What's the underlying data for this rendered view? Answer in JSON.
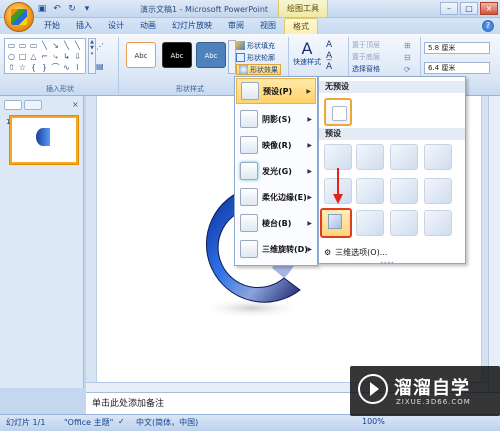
{
  "titlebar": {
    "doc_title": "演示文稿1 - Microsoft PowerPoint",
    "context_tab_group": "绘图工具",
    "qat_icons": [
      "save-icon",
      "undo-icon",
      "redo-icon",
      "customize-icon"
    ],
    "window_controls": {
      "minimize": "–",
      "maximize": "□",
      "close": "×"
    }
  },
  "tabs": [
    {
      "label": "开始"
    },
    {
      "label": "插入"
    },
    {
      "label": "设计"
    },
    {
      "label": "动画"
    },
    {
      "label": "幻灯片放映"
    },
    {
      "label": "审阅"
    },
    {
      "label": "视图"
    },
    {
      "label": "格式"
    }
  ],
  "ribbon": {
    "insert_shapes_label": "插入形状",
    "shape_styles_label": "形状样式",
    "style_sample": "Abc",
    "shape_fill": "形状填充",
    "shape_outline": "形状轮廓",
    "shape_effects": "形状效果",
    "quick_styles": "快速样式",
    "bring_front": "置于顶层",
    "send_back": "置于底层",
    "selection_pane": "选择窗格",
    "height_value": "5.8 厘米",
    "width_value": "6.4 厘米"
  },
  "effects_menu": {
    "items": [
      {
        "label": "预设(P)"
      },
      {
        "label": "阴影(S)"
      },
      {
        "label": "映像(R)"
      },
      {
        "label": "发光(G)"
      },
      {
        "label": "柔化边缘(E)"
      },
      {
        "label": "棱台(B)"
      },
      {
        "label": "三维旋转(D)"
      }
    ]
  },
  "presets_submenu": {
    "no_preset_header": "无预设",
    "preset_header": "预设",
    "options_label": "三维选项(O)..."
  },
  "statusbar": {
    "slide_info": "幻灯片 1/1",
    "theme": "\"Office 主题\"",
    "language": "中文(简体，中国)",
    "zoom": "100%"
  },
  "notes_placeholder": "单击此处添加备注",
  "watermark": {
    "title": "溜溜自学",
    "url": "ZIXUE.3D66.COM"
  },
  "colors": {
    "accent": "#4f81bd",
    "selected_border": "#e23b1d",
    "menu_hover": "#ffd36a"
  }
}
